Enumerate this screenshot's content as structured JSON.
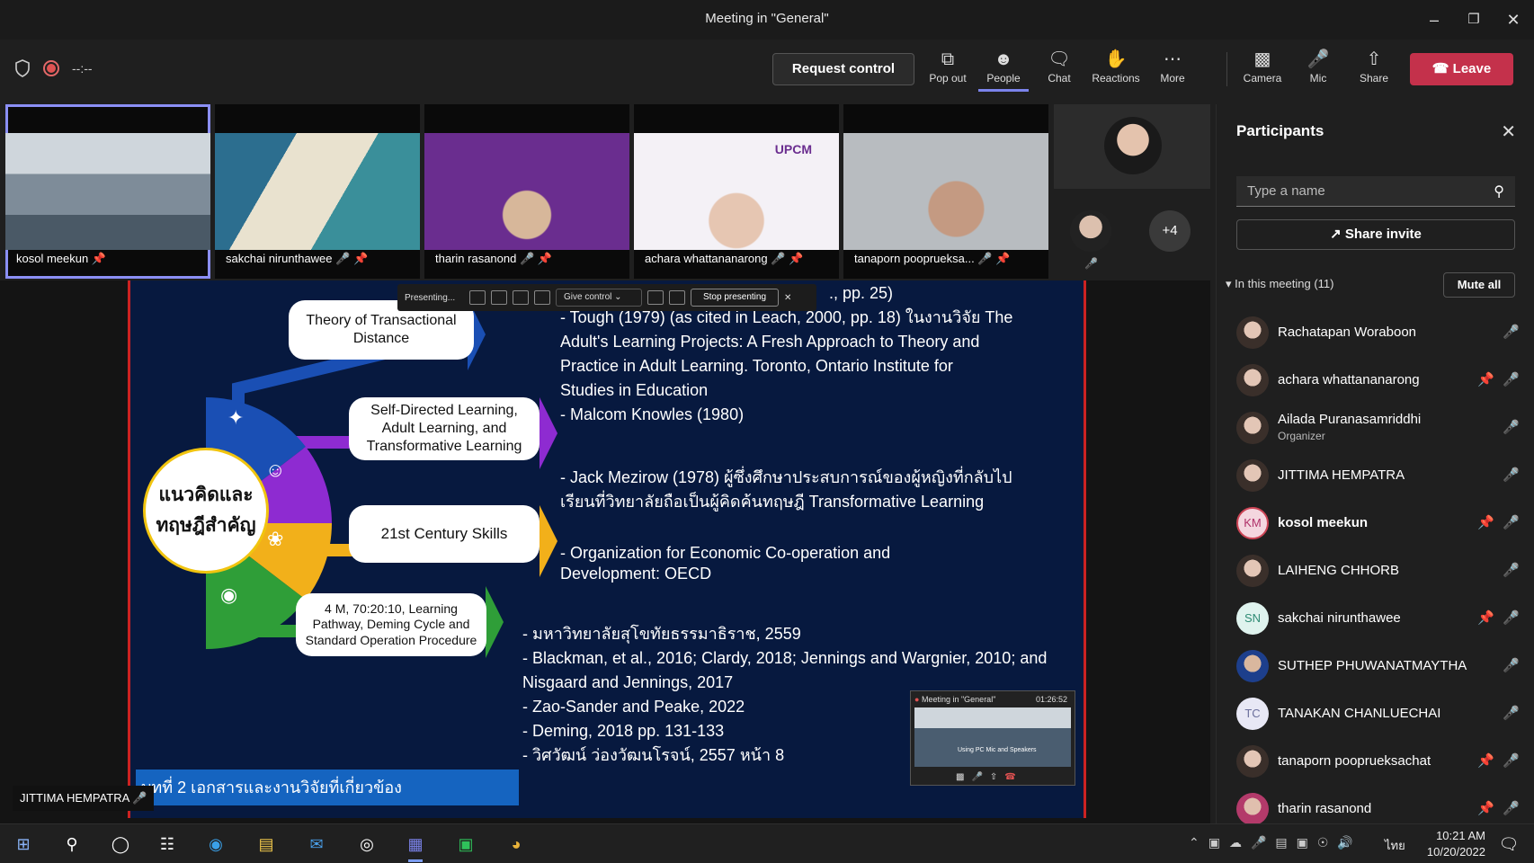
{
  "window": {
    "title": "Meeting in \"General\""
  },
  "toolbar": {
    "timer": "--:--",
    "request_control": "Request control",
    "buttons": [
      {
        "label": "Pop out",
        "icon": "pop-out-icon"
      },
      {
        "label": "People",
        "icon": "people-icon"
      },
      {
        "label": "Chat",
        "icon": "chat-icon"
      },
      {
        "label": "Reactions",
        "icon": "reactions-icon"
      },
      {
        "label": "More",
        "icon": "more-icon"
      },
      {
        "label": "Camera",
        "icon": "camera-off-icon"
      },
      {
        "label": "Mic",
        "icon": "mic-off-icon"
      },
      {
        "label": "Share",
        "icon": "share-icon"
      }
    ],
    "leave": "Leave"
  },
  "video_strip": {
    "tiles": [
      {
        "name": "kosol meekun"
      },
      {
        "name": "sakchai nirunthawee"
      },
      {
        "name": "tharin rasanond"
      },
      {
        "name": "achara whattananarong"
      },
      {
        "name": "tanaporn pooprueksa..."
      }
    ],
    "overflow": "+4"
  },
  "presenting_bar": {
    "status": "Presenting...",
    "give_control": "Give control",
    "stop": "Stop presenting"
  },
  "slide": {
    "top_fragment": "., pp. 25)",
    "center": "แนวคิดและทฤษฎีสำคัญ",
    "center_line1": "แนวคิดและ",
    "center_line2": "ทฤษฎีสำคัญ",
    "pills": [
      {
        "line1": "Theory of Transactional",
        "line2": "Distance",
        "line3": ""
      },
      {
        "line1": "Self-Directed Learning,",
        "line2": "Adult Learning, and",
        "line3": "Transformative Learning"
      },
      {
        "line1": "21st Century Skills",
        "line2": "",
        "line3": ""
      },
      {
        "line1": "4 M, 70:20:10, Learning",
        "line2": "Pathway, Deming Cycle and",
        "line3": "Standard Operation Procedure"
      }
    ],
    "refs": {
      "r1a": "- Tough (1979) (as cited in Leach,  2000, pp. 18) ในงานวิจัย The",
      "r1b": "Adult's Learning Projects: A Fresh Approach to Theory and",
      "r1c": "Practice in Adult Learning. Toronto, Ontario Institute for",
      "r1d": "Studies in Education",
      "r1e": "- Malcom Knowles (1980)",
      "r2a": "- Jack Mezirow  (1978) ผู้ซึ่งศึกษาประสบการณ์ของผู้หญิงที่กลับไป",
      "r2b": "เรียนที่วิทยาลัยถือเป็นผู้คิดค้นทฤษฎี Transformative Learning",
      "r3a": "- Organization for Economic Co-operation and",
      "r3b": "Development: OECD",
      "r4a": "- มหาวิทยาลัยสุโขทัยธรรมาธิราช, 2559",
      "r4b": "- Blackman, et al., 2016; Clardy, 2018; Jennings and Wargnier, 2010; and",
      "r4c": "Nisgaard and Jennings, 2017",
      "r4d": "- Zao-Sander and Peake, 2022",
      "r4e": "- Deming, 2018 pp. 131-133",
      "r4f": "- วิศวัฒน์ ว่องวัฒนโรจน์, 2557 หน้า 8"
    },
    "caption": "บทที่ 2 เอกสารและงานวิจัยที่เกี่ยวข้อง",
    "upcm": "UPCM"
  },
  "pip": {
    "title": "Meeting in \"General\"",
    "time": "01:26:52",
    "hint": "Using PC Mic and Speakers"
  },
  "active_speaker_label": "JITTIMA HEMPATRA",
  "participants": {
    "title": "Participants",
    "search_placeholder": "Type a name",
    "share_invite": "Share invite",
    "in_meeting": "In this meeting (11)",
    "mute_all": "Mute all",
    "list": [
      {
        "name": "Rachatapan Woraboon",
        "avatar": "photo",
        "pinned": false,
        "mic": "off"
      },
      {
        "name": "achara whattananarong",
        "avatar": "photo",
        "pinned": true,
        "mic": "off"
      },
      {
        "name": "Ailada Puranasamriddhi",
        "role": "Organizer",
        "avatar": "photo",
        "pinned": false,
        "mic": "off"
      },
      {
        "name": "JITTIMA HEMPATRA",
        "avatar": "photo",
        "pinned": false,
        "mic": "off"
      },
      {
        "name": "kosol meekun",
        "avatar": "KM",
        "pinned": true,
        "mic": "on"
      },
      {
        "name": "LAIHENG CHHORB",
        "avatar": "photo",
        "pinned": false,
        "mic": "off"
      },
      {
        "name": "sakchai nirunthawee",
        "avatar": "SN",
        "pinned": true,
        "mic": "off"
      },
      {
        "name": "SUTHEP PHUWANATMAYTHA",
        "avatar": "photo",
        "pinned": false,
        "mic": "off"
      },
      {
        "name": "TANAKAN CHANLUECHAI",
        "avatar": "TC",
        "pinned": false,
        "mic": "off"
      },
      {
        "name": "tanaporn pooprueksachat",
        "avatar": "photo",
        "pinned": true,
        "mic": "off"
      },
      {
        "name": "tharin rasanond",
        "avatar": "photo",
        "pinned": true,
        "mic": "off"
      }
    ]
  },
  "taskbar": {
    "lang": "ไทย",
    "time": "10:21 AM",
    "date": "10/20/2022"
  },
  "colors": {
    "accent": "#7b83eb",
    "leave": "#c4314b",
    "slide_bg": "#07193f",
    "caption": "#1564c0"
  }
}
